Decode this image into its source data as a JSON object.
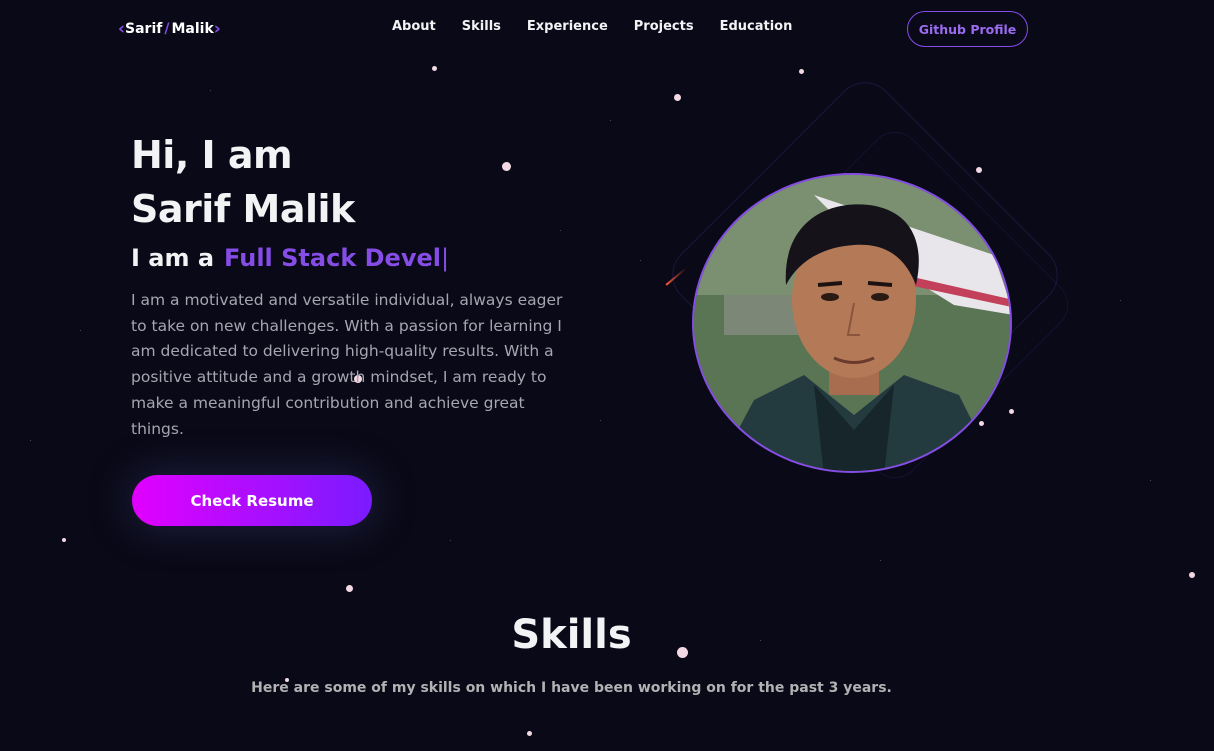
{
  "nav": {
    "logo_first": "Sarif",
    "logo_slash": "/",
    "logo_last": "Malik",
    "links": [
      "About",
      "Skills",
      "Experience",
      "Projects",
      "Education"
    ],
    "github_label": "Github Profile"
  },
  "hero": {
    "title": "Hi, I am\nSarif Malik",
    "role_prefix": "I am a",
    "role_typed": "Full Stack Devel",
    "cursor": "|",
    "description": "I am a motivated and versatile individual, always eager to take on new challenges. With a passion for learning I am dedicated to delivering high-quality results. With a positive attitude and a growth mindset, I am ready to make a meaningful contribution and achieve great things.",
    "resume_label": "Check Resume"
  },
  "skills": {
    "title": "Skills",
    "subtitle": "Here are some of my skills on which I have been working on for the past 3 years."
  },
  "colors": {
    "background": "#090917",
    "accent": "#854ce6",
    "button_start": "#e100ff",
    "button_end": "#7a1bff",
    "text_primary": "#f2f3f4",
    "text_secondary": "#a5a6b0"
  },
  "icons": {
    "logo_left": "chevron-left-icon",
    "logo_right": "chevron-right-icon"
  }
}
